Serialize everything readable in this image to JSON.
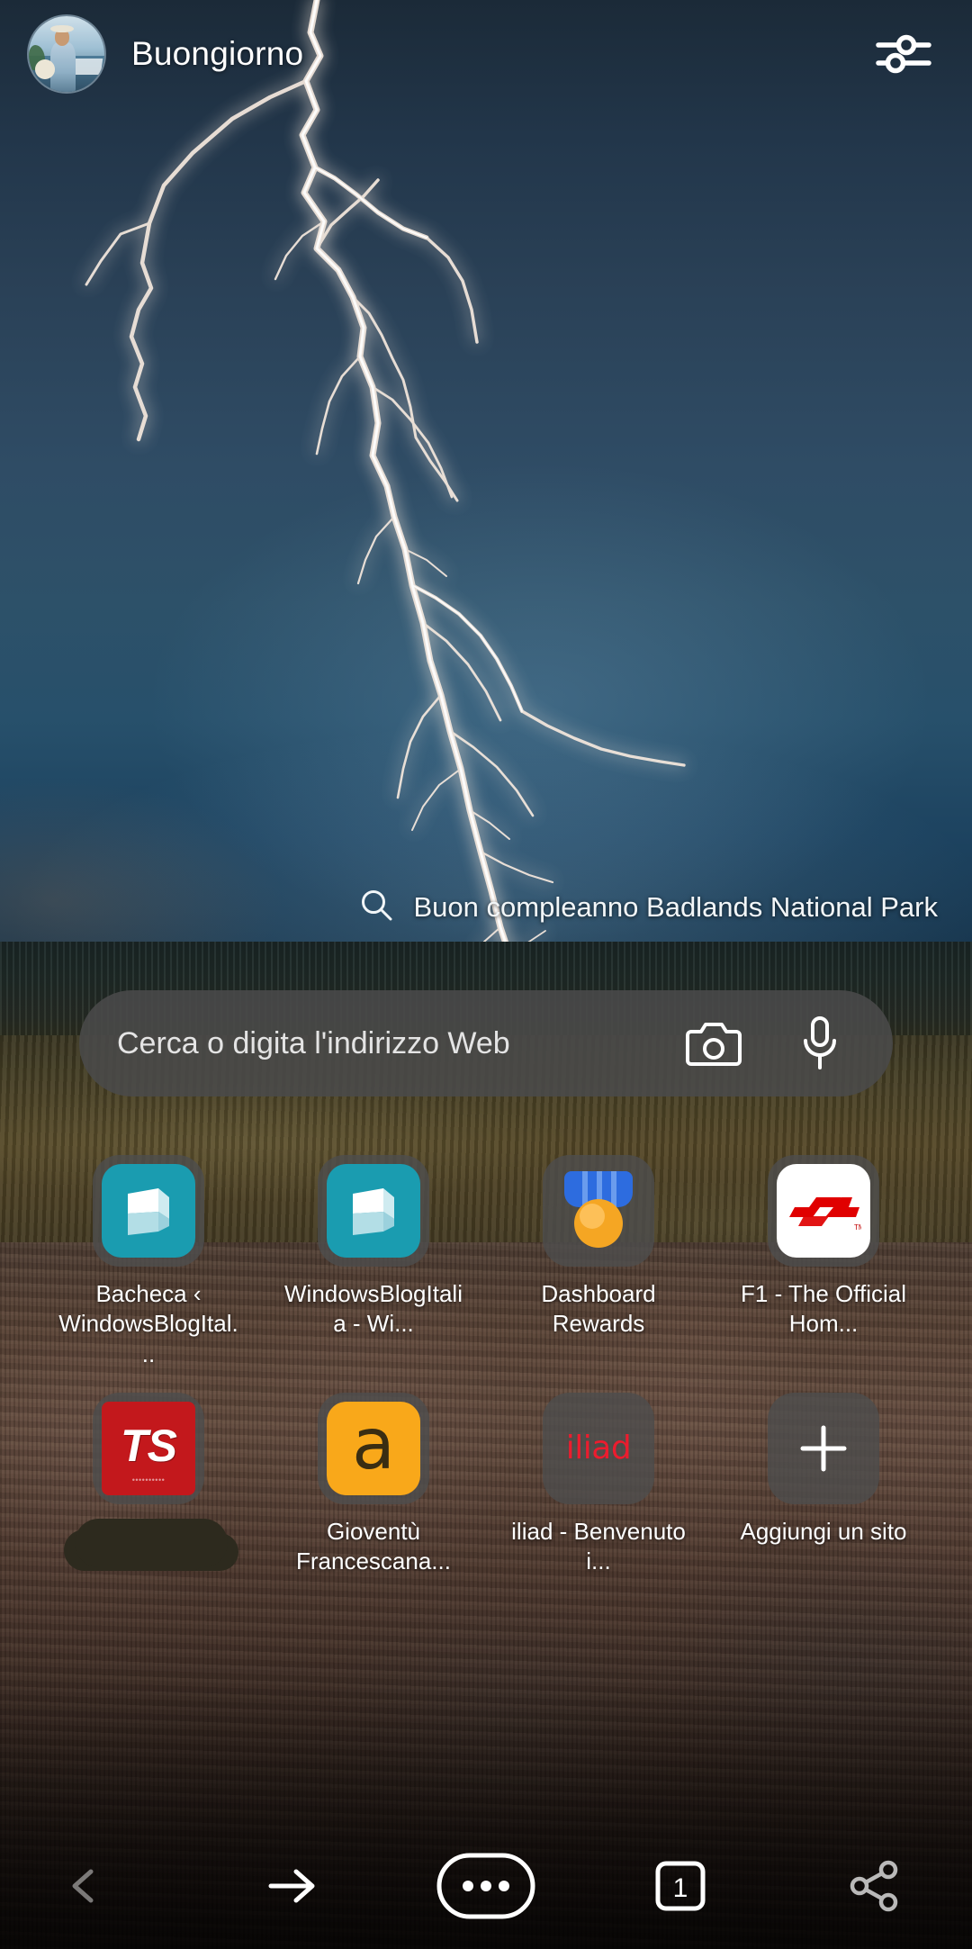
{
  "header": {
    "greeting": "Buongiorno",
    "avatar_name": "user-avatar",
    "settings_icon": "sliders-icon"
  },
  "hero": {
    "caption": "Buon compleanno Badlands National Park",
    "caption_icon": "search-icon",
    "image_subject": "lightning-over-badlands"
  },
  "search": {
    "placeholder": "Cerca o digita l'indirizzo Web",
    "camera_icon": "camera-icon",
    "mic_icon": "microphone-icon"
  },
  "shortcuts": [
    {
      "label": "Bacheca ‹ WindowsBlogItal...",
      "icon": "windowsblog-icon",
      "redacted": false
    },
    {
      "label": "WindowsBlogItalia - Wi...",
      "icon": "windowsblog-icon",
      "redacted": false
    },
    {
      "label": "Dashboard Rewards",
      "icon": "rewards-medal-icon",
      "redacted": false
    },
    {
      "label": "F1 - The Official Hom...",
      "icon": "f1-icon",
      "redacted": false
    },
    {
      "label": "",
      "icon": "ts-icon",
      "redacted": true
    },
    {
      "label": "Gioventù Francescana...",
      "icon": "gioventu-francescana-icon",
      "redacted": false
    },
    {
      "label": "iliad - Benvenuto i...",
      "icon": "iliad-icon",
      "redacted": false
    },
    {
      "label": "Aggiungi un sito",
      "icon": "plus-icon",
      "redacted": false
    }
  ],
  "bottom_nav": {
    "back_label": "back-arrow-icon",
    "forward_label": "forward-arrow-icon",
    "menu_label": "more-menu-icon",
    "tabs_count": "1",
    "share_label": "share-icon"
  },
  "colors": {
    "accent_teal": "#1a9cb0",
    "f1_red": "#ec1c2e",
    "iliad_red": "#ec1c2e",
    "rewards_orange": "#f5a623",
    "rewards_blue": "#2d6cdf",
    "ts_red": "#c3181c",
    "gf_orange": "#f9a81a",
    "chrome_gray": "rgba(74,74,74,0.88)"
  }
}
